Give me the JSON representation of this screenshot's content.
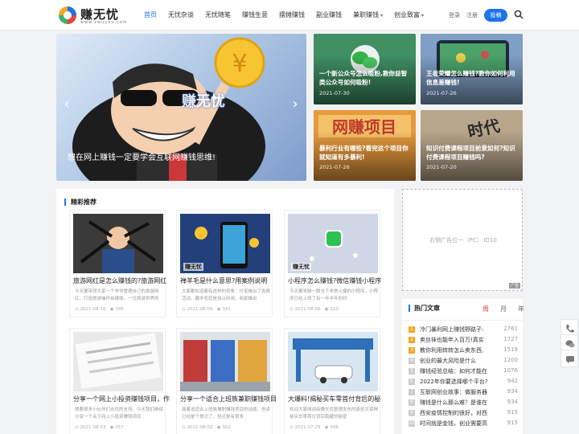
{
  "header": {
    "logo_text": "赚无忧",
    "logo_sub": "www.zwuyou.com",
    "nav": [
      {
        "label": "首页",
        "active": true,
        "dropdown": false
      },
      {
        "label": "无忧杂谈",
        "active": false,
        "dropdown": false
      },
      {
        "label": "无忧随笔",
        "active": false,
        "dropdown": false
      },
      {
        "label": "赚钱生意",
        "active": false,
        "dropdown": false
      },
      {
        "label": "摆摊赚钱",
        "active": false,
        "dropdown": false
      },
      {
        "label": "副业赚钱",
        "active": false,
        "dropdown": false
      },
      {
        "label": "兼职赚钱",
        "active": false,
        "dropdown": true
      },
      {
        "label": "创业致富",
        "active": false,
        "dropdown": true
      }
    ],
    "login": "登录",
    "register": "注册",
    "post_button": "投稿"
  },
  "hero": {
    "caption": "想在网上赚钱一定要学会互联网赚钱思维!",
    "watermark": "赚无忧",
    "slides": 2,
    "active_slide": 2
  },
  "tiles": [
    {
      "title": "一个新公众号怎么吸粉,教你益智类公众号如何吸粉!",
      "date": "2021-07-30",
      "bg": "#4a9b6a"
    },
    {
      "title": "王者荣耀怎么赚钱?教你如何利用信息差赚钱!",
      "date": "2021-07-26",
      "bg": "#5b83b8"
    },
    {
      "title": "暴利行业有哪些?看完这个项目你就知道有多暴利!",
      "date": "2021-07-26",
      "bg": "#c0792c"
    },
    {
      "title": "知识付费课程项目前景如何?知识付费课程项目赚钱吗?",
      "date": "2021-07-20",
      "bg": "#7c6a55"
    }
  ],
  "featured": {
    "heading": "精彩推荐",
    "cards": [
      {
        "title": "旅游网红是怎么赚钱的?旅游网红",
        "desc": "今天要带领大家一个学学管理自己的旅游网红，打造旅游操作自媒体。一位周游世界的",
        "date": "2021-08-10",
        "views": "346"
      },
      {
        "title": "禅羊毛是什么意思?用案例说明",
        "desc": "大家都知道都有这样的现象：付宝推出了免费活动，薅羊毛就是加以利用，商家推出",
        "date": "2021-08-09",
        "views": "341"
      },
      {
        "title": "小程序怎么赚钱?微信赚钱小程序",
        "desc": "今天要来聊一聊当下非常火爆的小程序，小程序已经上线了有一年半年的时",
        "date": "2021-08-06",
        "views": "310"
      },
      {
        "title": "分享一个网上小投资赚钱项目，作",
        "desc": "想要很多小伙伴们去找的支持。今天我们继续分享一个关于网上小投资赚钱项目",
        "date": "2021-08-03",
        "views": "357"
      },
      {
        "title": "分享一个适合上班族兼职赚钱项目",
        "desc": "接着说适合上班族兼职赚钱项目的话题，但讲已经是个常识了，但还是有很多",
        "date": "2021-08-02",
        "views": "302"
      },
      {
        "title": "大爆料!揭秘买车零首付背后的秘",
        "desc": "欢迎大家阅读由赚无忧整理发布的原创文章揭秘买车零首付背后隐藏的秘密",
        "date": "2021-07-29",
        "views": "346"
      }
    ]
  },
  "ad": {
    "text": "右侧广告位一（PC） ID10",
    "tag": "广告"
  },
  "hot": {
    "heading": "热门文章",
    "tabs": [
      "周",
      "月",
      "年"
    ],
    "items": [
      {
        "rank": "1",
        "title": "冷门暴利网上赚钱野路子:",
        "count": "2761"
      },
      {
        "rank": "2",
        "title": "卖丝袜也能年入百万!真实",
        "count": "1727"
      },
      {
        "rank": "3",
        "title": "教你利用转转怎么卖东西,",
        "count": "1519"
      },
      {
        "rank": "4",
        "title": "创业的最大风险是什么",
        "count": "1200"
      },
      {
        "rank": "5",
        "title": "赚钱经验总结：如何才能在",
        "count": "1076"
      },
      {
        "rank": "6",
        "title": "2022年你要选择哪个平台?",
        "count": "942"
      },
      {
        "rank": "7",
        "title": "互联网创业故事：做服务器",
        "count": "934"
      },
      {
        "rank": "8",
        "title": "赚钱是什么那么难？是谁在",
        "count": "934"
      },
      {
        "rank": "9",
        "title": "西安疫情控制的很好，对西",
        "count": "915"
      },
      {
        "rank": "10",
        "title": "时间就是金钱，创业需要高",
        "count": "915"
      }
    ]
  },
  "colors": {
    "accent": "#1e73e8",
    "hot_active": "#e8453c",
    "rank_top": "#f5a623"
  }
}
